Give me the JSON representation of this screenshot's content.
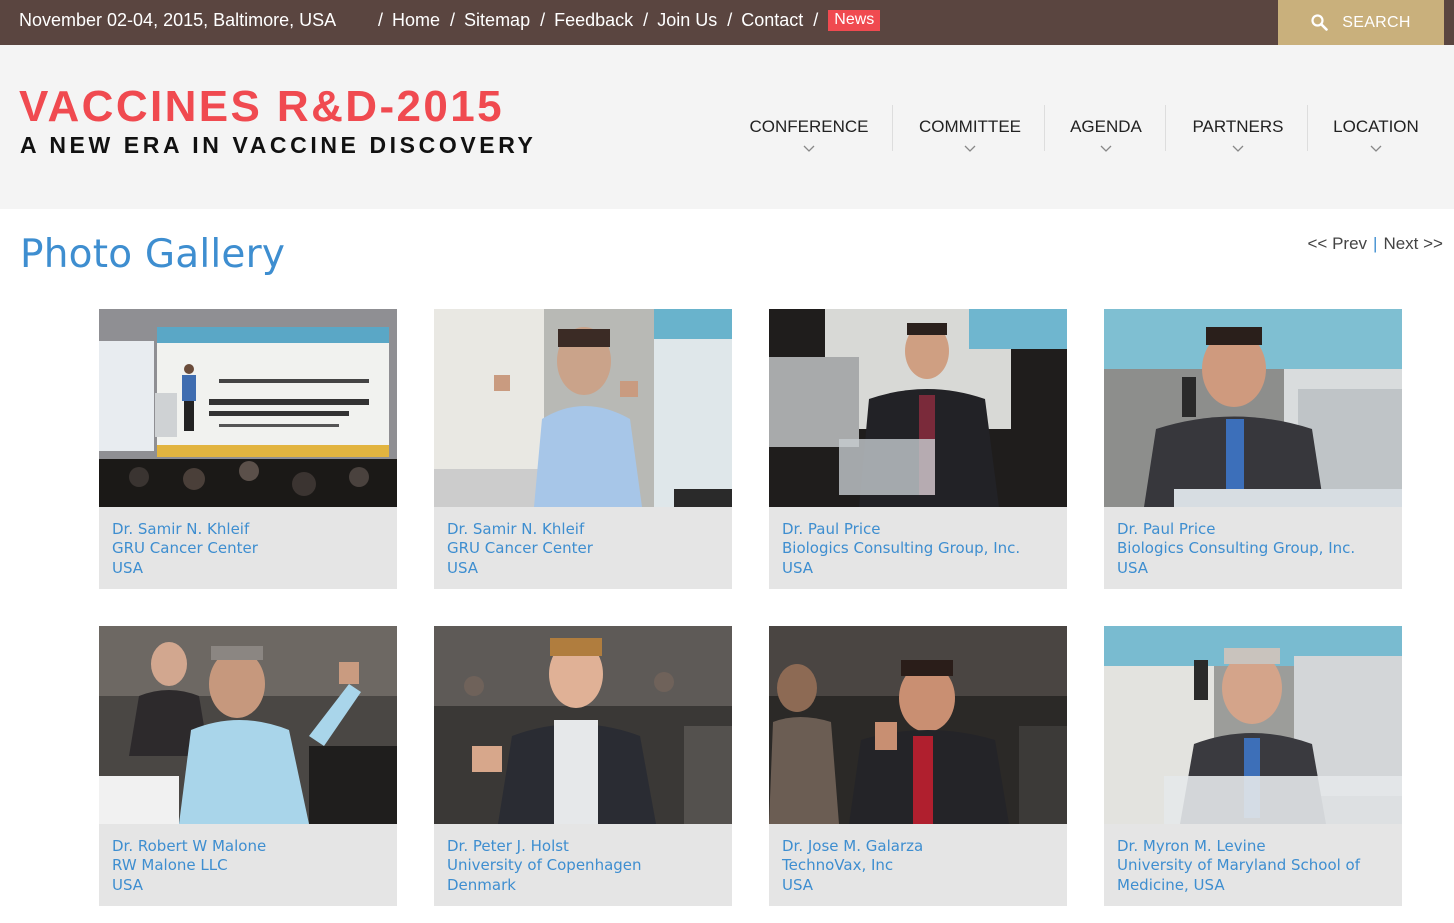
{
  "topbar": {
    "date_location": "November 02-04, 2015, Baltimore, USA",
    "links": [
      "Home",
      "Sitemap",
      "Feedback",
      "Join Us",
      "Contact"
    ],
    "news_badge": "News",
    "search_label": "SEARCH"
  },
  "header": {
    "title": "VACCINES R&D-2015",
    "tagline": "A NEW ERA IN VACCINE DISCOVERY"
  },
  "nav": [
    "CONFERENCE",
    "COMMITTEE",
    "AGENDA",
    "PARTNERS",
    "LOCATION"
  ],
  "gallery": {
    "title": "Photo Gallery",
    "prev": "<< Prev",
    "next": "Next >>",
    "items": [
      {
        "name": "Dr. Samir N. Khleif",
        "org": "GRU Cancer Center",
        "country": "USA"
      },
      {
        "name": "Dr. Samir N. Khleif",
        "org": "GRU Cancer Center",
        "country": "USA"
      },
      {
        "name": "Dr. Paul Price",
        "org": "Biologics Consulting Group, Inc.",
        "country": "USA"
      },
      {
        "name": "Dr. Paul Price",
        "org": "Biologics Consulting Group, Inc.",
        "country": "USA"
      },
      {
        "name": "Dr. Robert W Malone",
        "org": "RW Malone LLC",
        "country": "USA"
      },
      {
        "name": "Dr. Peter J. Holst",
        "org": "University of Copenhagen",
        "country": "Denmark"
      },
      {
        "name": "Dr. Jose M. Galarza",
        "org": "TechnoVax, Inc",
        "country": "USA"
      },
      {
        "name": "Dr. Myron M. Levine",
        "org": "University of Maryland School of",
        "country": "Medicine, USA"
      }
    ]
  }
}
